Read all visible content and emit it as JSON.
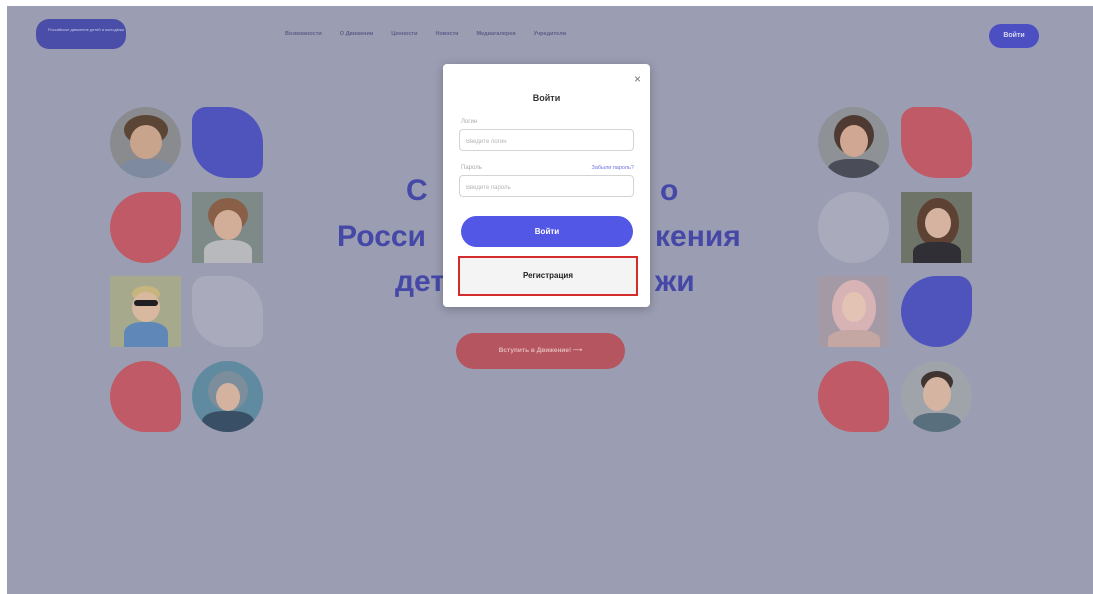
{
  "header": {
    "logo_text": "Российское движение детей и молодёжи",
    "nav": [
      "Возможности",
      "О Движении",
      "Ценности",
      "Новости",
      "Медиагалерея",
      "Учредители"
    ],
    "login_label": "Войти"
  },
  "hero": {
    "line1": "С",
    "line1_right": "о",
    "line2_left": "Росси",
    "line2_right": "кения",
    "line3_left": "дет",
    "line3_right": "жи",
    "cta_label": "Вступить в Движение! ⟶"
  },
  "modal": {
    "close": "×",
    "title": "Войти",
    "login_label": "Логин",
    "login_placeholder": "Введите логин",
    "password_label": "Пароль",
    "forgot_label": "Забыли пароль?",
    "password_placeholder": "Введите пароль",
    "submit_label": "Войти",
    "register_label": "Регистрация"
  },
  "colors": {
    "overlay": "#9b9eb3",
    "accent_blue": "#5357e6",
    "accent_red": "#bf5a66",
    "highlight": "#d32c2c"
  }
}
